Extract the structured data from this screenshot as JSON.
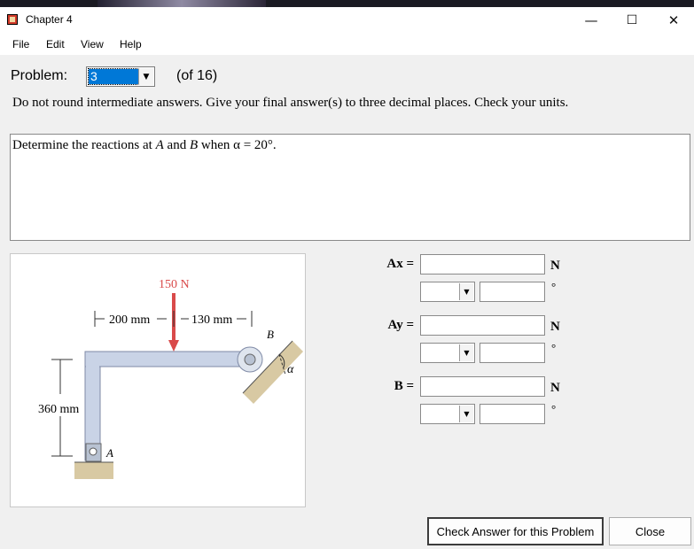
{
  "window": {
    "title": "Chapter 4",
    "minimize_glyph": "—",
    "maximize_glyph": "☐",
    "close_glyph": "✕"
  },
  "menu": [
    "File",
    "Edit",
    "View",
    "Help"
  ],
  "problem": {
    "label": "Problem:",
    "selected": "3",
    "of_text": "(of 16)"
  },
  "instructions": "Do not round intermediate answers.  Give your final answer(s) to three decimal places.  Check your units.",
  "question": {
    "prefix": "Determine the reactions at ",
    "A": "A",
    "mid": " and ",
    "B": "B",
    "suffix": " when α = 20°."
  },
  "figure": {
    "force_label": "150 N",
    "dim_left": "200 mm",
    "dim_right": "130 mm",
    "dim_height": "360 mm",
    "point_a": "A",
    "point_b": "B",
    "angle": "α"
  },
  "answers": [
    {
      "label": "Ax =",
      "unit": "N",
      "deg": "°",
      "value": "",
      "angle": ""
    },
    {
      "label": "Ay =",
      "unit": "N",
      "deg": "°",
      "value": "",
      "angle": ""
    },
    {
      "label": "B =",
      "unit": "N",
      "deg": "°",
      "value": "",
      "angle": ""
    }
  ],
  "buttons": {
    "check": "Check Answer for this Problem",
    "close": "Close"
  },
  "colors": {
    "selection": "#0078d7",
    "force": "#d94a4a",
    "frame": "#c9d3e6"
  }
}
